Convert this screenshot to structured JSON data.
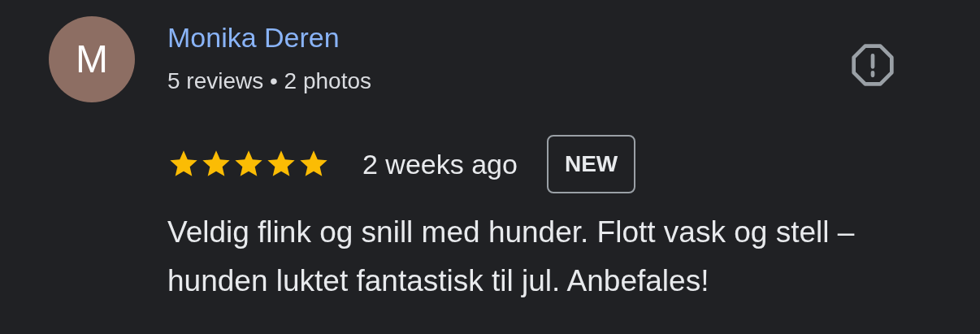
{
  "review": {
    "avatar_letter": "M",
    "author": "Monika Deren",
    "meta": "5 reviews • 2 photos",
    "stars": 5,
    "time": "2 weeks ago",
    "badge": "NEW",
    "text": "Veldig flink og snill med hunder. Flott vask og stell – hunden luktet fantastisk til jul. Anbefales!"
  }
}
